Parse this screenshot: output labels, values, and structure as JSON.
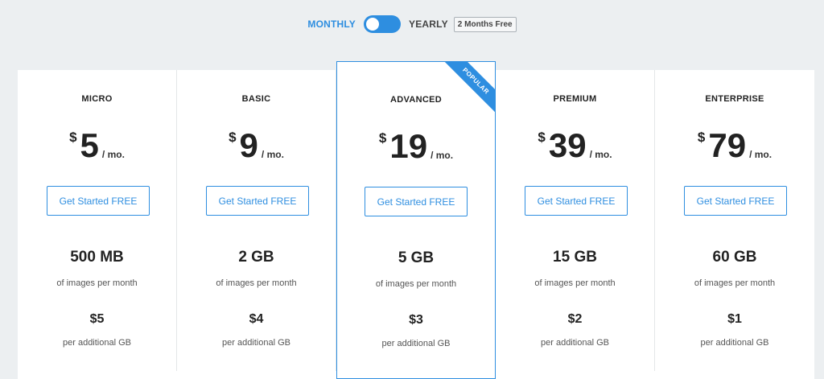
{
  "billing": {
    "monthly_label": "MONTHLY",
    "yearly_label": "YEARLY",
    "yearly_badge": "2 Months Free",
    "selected": "monthly"
  },
  "plans": [
    {
      "name": "MICRO",
      "currency": "$",
      "price": "5",
      "period": "/ mo.",
      "cta": "Get Started FREE",
      "storage": "500 MB",
      "storage_sub": "of images per month",
      "extra": "$5",
      "extra_sub": "per additional GB"
    },
    {
      "name": "BASIC",
      "currency": "$",
      "price": "9",
      "period": "/ mo.",
      "cta": "Get Started FREE",
      "storage": "2 GB",
      "storage_sub": "of images per month",
      "extra": "$4",
      "extra_sub": "per additional GB"
    },
    {
      "name": "ADVANCED",
      "currency": "$",
      "price": "19",
      "period": "/ mo.",
      "cta": "Get Started FREE",
      "storage": "5 GB",
      "storage_sub": "of images per month",
      "extra": "$3",
      "extra_sub": "per additional GB",
      "ribbon": "POPULAR"
    },
    {
      "name": "PREMIUM",
      "currency": "$",
      "price": "39",
      "period": "/ mo.",
      "cta": "Get Started FREE",
      "storage": "15 GB",
      "storage_sub": "of images per month",
      "extra": "$2",
      "extra_sub": "per additional GB"
    },
    {
      "name": "ENTERPRISE",
      "currency": "$",
      "price": "79",
      "period": "/ mo.",
      "cta": "Get Started FREE",
      "storage": "60 GB",
      "storage_sub": "of images per month",
      "extra": "$1",
      "extra_sub": "per additional GB"
    }
  ],
  "colors": {
    "accent": "#2e8ee0",
    "background": "#eceff1",
    "card": "#ffffff"
  }
}
